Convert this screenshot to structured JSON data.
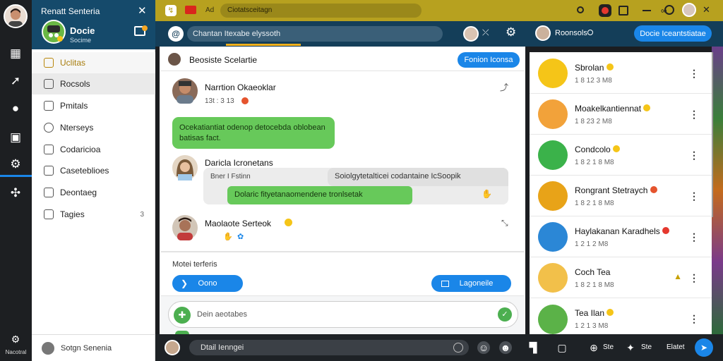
{
  "sidebar": {
    "app_title": "Renatt Senteria",
    "brand_name": "Docie",
    "brand_sub": "Socime",
    "items": [
      {
        "label": "Uclitas",
        "active": true
      },
      {
        "label": "Rocsols",
        "active": false
      },
      {
        "label": "Pmitals",
        "active": false
      },
      {
        "label": "Nterseys",
        "active": false
      },
      {
        "label": "Codaricioa",
        "active": false
      },
      {
        "label": "Caseteblioes",
        "active": false
      },
      {
        "label": "Deontaeg",
        "active": false
      },
      {
        "label": "Tagies",
        "active": false
      }
    ],
    "last_item_badge": "3",
    "footer_label": "Sotgn Senenia",
    "rail_footer_label": "Nacotral"
  },
  "topbar": {
    "search_text": "Ciotatsceitagn",
    "tag_label": "Ad"
  },
  "chat_header": {
    "search_text": "Chantan Itexabe elyssoth",
    "contact_name": "Roonsols",
    "action_button": "Docie Iceantstiatae"
  },
  "thread": {
    "title": "Beosiste Scelartie",
    "action_button": "Fonion Iconsa",
    "messages": [
      {
        "name": "Narrtion Okaeoklar",
        "time": "13t : 3 13"
      },
      {
        "name": "Daricla Icronetans",
        "time": ""
      },
      {
        "name": "Maolaote Serteok",
        "time": ""
      }
    ],
    "green_bubble": "Ocekatiantiat odenop detocebda oblobean batisas fact.",
    "quote_left": "Bner I Fstinn",
    "quote_right": "Soiolgytetalticei codantaine IcSoopik",
    "green_bar": "Dolaric fityetanaomendene tronlsetak",
    "section_label": "Motei terferis",
    "btn_primary": "Oono",
    "btn_secondary": "Lagoneile",
    "compose_placeholder": "Dein aeotabes"
  },
  "contacts": [
    {
      "name": "Sbrolan",
      "status": "1 8 12 3 M8",
      "avatar_color": "#f5c518"
    },
    {
      "name": "Moakelkantiennat",
      "status": "1 8 23 2 M8",
      "avatar_color": "#f2a23a"
    },
    {
      "name": "Condcolo",
      "status": "1 8 2 1 8 M8",
      "avatar_color": "#3bb24a"
    },
    {
      "name": "Rongrant Stetraych",
      "status": "1 8 2 1 8 M8",
      "avatar_color": "#e8a318"
    },
    {
      "name": "Haylakanan Karadhels",
      "status": "1 2 1 2 M8",
      "avatar_color": "#2b87d6"
    },
    {
      "name": "Coch Tea",
      "status": "1 8 2 1 8 M8",
      "avatar_color": "#f2c04a"
    },
    {
      "name": "Tea Ilan",
      "status": "1 2 1 3 M8",
      "avatar_color": "#5bb248"
    }
  ],
  "bottombar": {
    "input_text": "Dtail Ienngei",
    "action1": "Ste",
    "action2": "Ste",
    "action3": "Elatet"
  },
  "colors": {
    "accent_blue": "#1a86e8",
    "header_navy": "#143e59",
    "topbar_gold": "#b7a11f",
    "bubble_green": "#67c95a"
  }
}
